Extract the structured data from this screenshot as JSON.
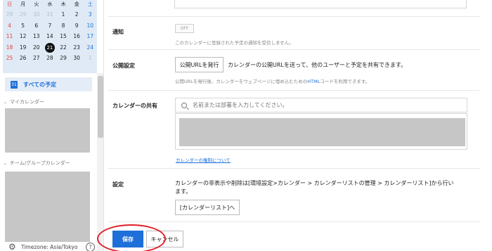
{
  "sidebar": {
    "calendar": {
      "weekdays": [
        "日",
        "月",
        "火",
        "水",
        "木",
        "金",
        "土"
      ],
      "weeks": [
        [
          {
            "d": "28",
            "o": true
          },
          {
            "d": "29",
            "o": true
          },
          {
            "d": "30",
            "o": true
          },
          {
            "d": "31",
            "o": true
          },
          {
            "d": "1"
          },
          {
            "d": "2"
          },
          {
            "d": "3"
          }
        ],
        [
          {
            "d": "4"
          },
          {
            "d": "5"
          },
          {
            "d": "6"
          },
          {
            "d": "7"
          },
          {
            "d": "8"
          },
          {
            "d": "9"
          },
          {
            "d": "10"
          }
        ],
        [
          {
            "d": "11"
          },
          {
            "d": "12"
          },
          {
            "d": "13"
          },
          {
            "d": "14"
          },
          {
            "d": "15"
          },
          {
            "d": "16"
          },
          {
            "d": "17"
          }
        ],
        [
          {
            "d": "18"
          },
          {
            "d": "19"
          },
          {
            "d": "20"
          },
          {
            "d": "21",
            "today": true
          },
          {
            "d": "22"
          },
          {
            "d": "23"
          },
          {
            "d": "24"
          }
        ],
        [
          {
            "d": "25"
          },
          {
            "d": "26"
          },
          {
            "d": "27"
          },
          {
            "d": "28"
          },
          {
            "d": "29"
          },
          {
            "d": "30"
          },
          {
            "d": "1",
            "o": true
          }
        ]
      ]
    },
    "all_schedules_icon_text": "31",
    "all_schedules_label": "すべての予定",
    "my_calendars_label": "マイカレンダー",
    "team_calendars_label": "チーム/グループカレンダー",
    "timezone_label": "Timezone: Asia/Tokyo",
    "help_label": "?"
  },
  "settings": {
    "notify": {
      "label": "通知",
      "toggle": "OFF",
      "description": "このカレンダーに登録された予定の通知を受信しません。"
    },
    "public": {
      "label": "公開設定",
      "button": "公開URLを発行",
      "text": "カレンダーの公開URLを送って、他のユーザーと予定を共有できます。",
      "note_before": "公開URLを発行後、カレンダーをウェブページに埋め込むための",
      "note_highlight": "HTML",
      "note_after": "コードを利用できます。"
    },
    "share": {
      "label": "カレンダーの共有",
      "search_placeholder": "名前または部署を入力してください。",
      "link": "カレンダーの権制について"
    },
    "config": {
      "label": "設定",
      "text_line1": "カレンダーの非表示や削除は[環境設定>カレンダー > カレンダーリストの管理 > カレンダーリスト]から行い",
      "text_line2": "ます。",
      "button": "[カレンダーリスト]へ"
    }
  },
  "footer": {
    "save": "保存",
    "cancel": "キャンセル"
  },
  "colors": {
    "accent": "#1e6fd9",
    "calendar_bg": "#dfeaf6",
    "highlight_ring": "#e0202a"
  }
}
